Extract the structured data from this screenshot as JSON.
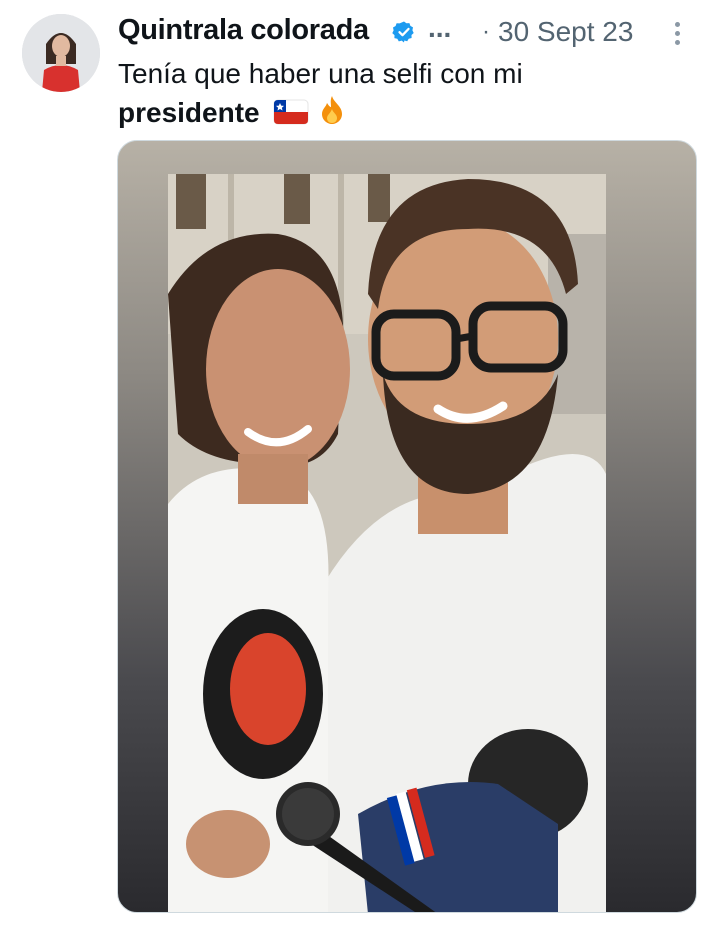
{
  "tweet": {
    "author": {
      "display_name": "Quintrala colorada",
      "verified": true,
      "truncation": "...",
      "avatar_icon": "profile-avatar"
    },
    "separator": "·",
    "date": "30 Sept 23",
    "text_line1": "Tenía que haber una selfi con mi",
    "text_bold": "presidente",
    "emojis": [
      "chile-flag-icon",
      "fire-icon"
    ],
    "more_icon": "more-options-icon"
  },
  "colors": {
    "text_primary": "#0f1419",
    "text_secondary": "#536471",
    "verified_blue": "#1d9bf0"
  }
}
